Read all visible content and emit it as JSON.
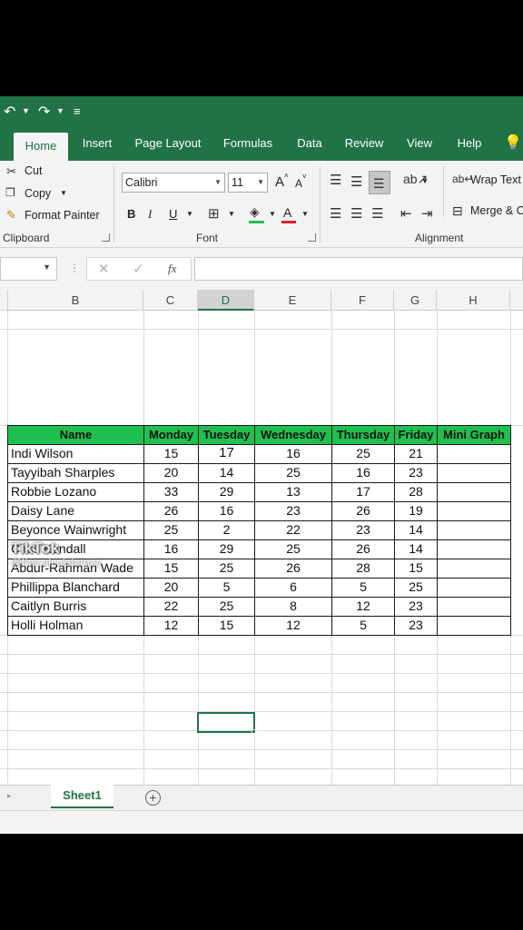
{
  "ribbon_tabs": [
    "Home",
    "Insert",
    "Page Layout",
    "Formulas",
    "Data",
    "Review",
    "View",
    "Help"
  ],
  "clipboard": {
    "cut": "Cut",
    "copy": "Copy",
    "format_painter": "Format Painter",
    "label": "Clipboard"
  },
  "font": {
    "name": "Calibri",
    "size": "11",
    "label": "Font",
    "bold": "B",
    "italic": "I",
    "underline": "U",
    "grow": "A",
    "shrink": "A"
  },
  "alignment": {
    "wrap_text": "Wrap Text",
    "merge": "Merge & C",
    "label": "Alignment"
  },
  "formula_bar": {
    "fx": "fx",
    "value": ""
  },
  "columns": [
    "B",
    "C",
    "D",
    "E",
    "F",
    "G",
    "H"
  ],
  "selected_column": "D",
  "table": {
    "headers": [
      "Name",
      "Monday",
      "Tuesday",
      "Wednesday",
      "Thursday",
      "Friday",
      "Mini Graph"
    ],
    "rows": [
      [
        "Indi Wilson",
        "15",
        "17",
        "16",
        "25",
        "21",
        ""
      ],
      [
        "Tayyibah Sharples",
        "20",
        "14",
        "25",
        "16",
        "23",
        ""
      ],
      [
        "Robbie Lozano",
        "33",
        "29",
        "13",
        "17",
        "28",
        ""
      ],
      [
        "Daisy Lane",
        "26",
        "16",
        "23",
        "26",
        "19",
        ""
      ],
      [
        "Beyonce Wainwright",
        "25",
        "2",
        "22",
        "23",
        "14",
        ""
      ],
      [
        "Cass Kendall",
        "16",
        "29",
        "25",
        "26",
        "14",
        ""
      ],
      [
        "Abdur-Rahman Wade",
        "15",
        "25",
        "26",
        "28",
        "15",
        ""
      ],
      [
        "Phillippa Blanchard",
        "20",
        "5",
        "6",
        "5",
        "25",
        ""
      ],
      [
        "Caitlyn Burris",
        "22",
        "25",
        "8",
        "12",
        "23",
        ""
      ],
      [
        "Holli Holman",
        "12",
        "15",
        "12",
        "5",
        "23",
        ""
      ]
    ]
  },
  "sheet_tab": "Sheet1",
  "add_sheet": "+",
  "watermark": {
    "brand": "TikTok",
    "handle": "@thecalculatorguy"
  },
  "colors": {
    "accent": "#217346",
    "header_fill": "#20c050"
  }
}
